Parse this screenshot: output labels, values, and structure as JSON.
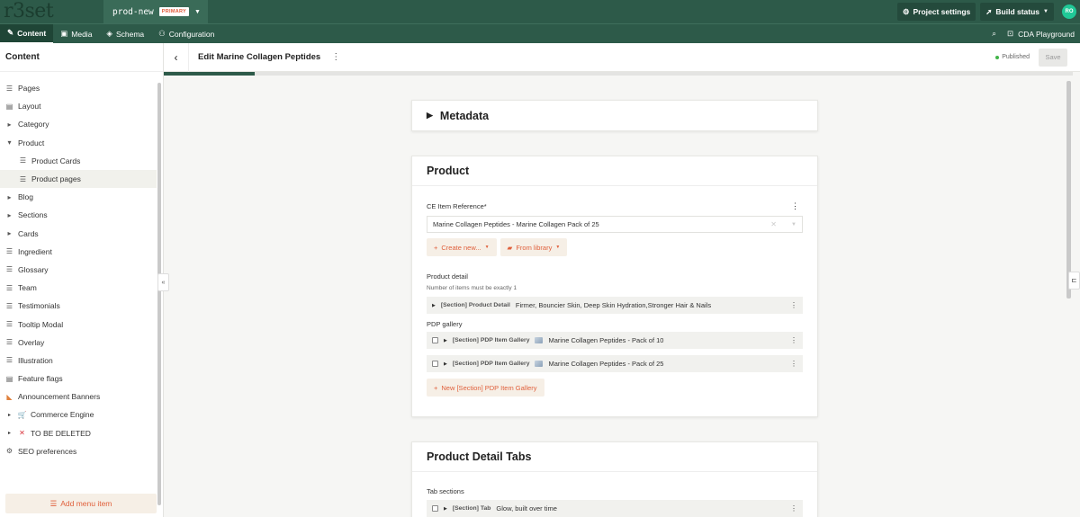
{
  "app": {
    "logo": "r3set",
    "env_name": "prod-new",
    "env_badge": "PRIMARY",
    "project_settings": "Project settings",
    "build_status": "Build status",
    "avatar_initials": "RO"
  },
  "nav": {
    "items": [
      {
        "label": "Content",
        "icon": "edit-icon"
      },
      {
        "label": "Media",
        "icon": "image-icon"
      },
      {
        "label": "Schema",
        "icon": "layers-icon"
      },
      {
        "label": "Configuration",
        "icon": "users-cog-icon"
      }
    ],
    "cda_playground": "CDA Playground"
  },
  "sidebar": {
    "title": "Content",
    "items": [
      {
        "label": "Pages",
        "icon": "list-icon"
      },
      {
        "label": "Layout",
        "icon": "doc-icon"
      },
      {
        "label": "Category",
        "icon": "triangle-right"
      },
      {
        "label": "Product",
        "icon": "triangle-down"
      },
      {
        "label": "Product Cards",
        "icon": "list-icon",
        "child": true
      },
      {
        "label": "Product pages",
        "icon": "list-icon",
        "child": true,
        "selected": true
      },
      {
        "label": "Blog",
        "icon": "triangle-right"
      },
      {
        "label": "Sections",
        "icon": "triangle-right"
      },
      {
        "label": "Cards",
        "icon": "triangle-right"
      },
      {
        "label": "Ingredient",
        "icon": "list-icon"
      },
      {
        "label": "Glossary",
        "icon": "list-icon"
      },
      {
        "label": "Team",
        "icon": "list-icon"
      },
      {
        "label": "Testimonials",
        "icon": "list-icon"
      },
      {
        "label": "Tooltip Modal",
        "icon": "list-icon"
      },
      {
        "label": "Overlay",
        "icon": "list-icon"
      },
      {
        "label": "Illustration",
        "icon": "list-icon"
      },
      {
        "label": "Feature flags",
        "icon": "doc-icon"
      },
      {
        "label": "Announcement Banners",
        "icon": "megaphone-icon"
      },
      {
        "label": "Commerce Engine",
        "icon": "cart-icon",
        "tri": true
      },
      {
        "label": "TO BE DELETED",
        "icon": "cross-icon",
        "tri": true
      },
      {
        "label": "SEO preferences",
        "icon": "gear-icon"
      }
    ],
    "add_menu_item": "Add menu item"
  },
  "header": {
    "title": "Edit Marine Collagen Peptides",
    "status": "Published",
    "save": "Save",
    "progress": 0.1
  },
  "metadata": {
    "title": "Metadata"
  },
  "product": {
    "title": "Product",
    "ce_label": "CE Item Reference*",
    "ce_value": "Marine Collagen Peptides - Marine Collagen Pack of 25",
    "create_new": "Create new...",
    "from_library": "From library",
    "detail_label": "Product detail",
    "detail_hint": "Number of items must be exactly 1",
    "detail_row_kind": "[Section] Product Detail",
    "detail_row_value": "Firmer, Bouncier Skin, Deep Skin Hydration,Stronger Hair & Nails",
    "gallery_label": "PDP gallery",
    "gallery_rows": [
      {
        "kind": "[Section] PDP Item Gallery",
        "value": "Marine Collagen Peptides - Pack of 10"
      },
      {
        "kind": "[Section] PDP Item Gallery",
        "value": "Marine Collagen Peptides - Pack of 25"
      }
    ],
    "new_gallery": "New [Section] PDP Item Gallery"
  },
  "tabs": {
    "title": "Product Detail Tabs",
    "tab_sections_label": "Tab sections",
    "row_kind": "[Section] Tab",
    "row_value": "Glow, built over time"
  }
}
